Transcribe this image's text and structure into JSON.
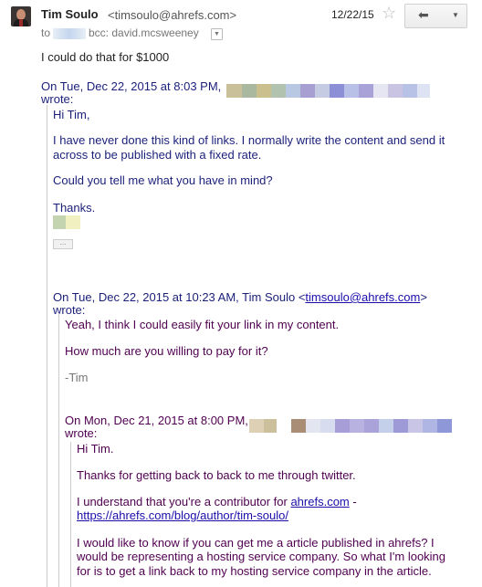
{
  "header": {
    "sender_name": "Tim Soulo",
    "sender_email": "<timsoulo@ahrefs.com>",
    "date": "12/22/15",
    "to_label": "to",
    "bcc_text": "bcc: david.mcsweeney",
    "star_icon": "star-outline-icon",
    "reply_icon": "reply-icon",
    "more_icon": "chevron-down-icon"
  },
  "body": {
    "reply_text": "I could do that for $1000"
  },
  "quote1": {
    "attribution": "On Tue, Dec 22, 2015 at 8:03 PM,",
    "wrote": "wrote:",
    "greeting": "Hi Tim,",
    "para1_line1": "I have never done this kind of links. I normally write the content and send it",
    "para1_line2": "across to be published with a fixed rate.",
    "para2": "Could you tell me what you have in mind?",
    "thanks": "Thanks.",
    "ellipsis": "..."
  },
  "quote2": {
    "attribution_prefix": "On Tue, Dec 22, 2015 at 10:23 AM, Tim Soulo <",
    "attribution_email": "timsoulo@ahrefs.com",
    "attribution_suffix": ">",
    "wrote": "wrote:",
    "line1": "Yeah, I think I could easily fit your link in my content.",
    "line2": "How much are you willing to pay for it?",
    "signature": "-Tim"
  },
  "quote3": {
    "attribution": "On Mon, Dec 21, 2015 at 8:00 PM,",
    "wrote": "wrote:",
    "greeting": "Hi Tim.",
    "line1": "Thanks for getting back to back to me through twitter.",
    "line2_prefix": "I understand that you're a contributor for ",
    "line2_link": "ahrefs.com",
    "line2_suffix": " -",
    "line3_link": "https://ahrefs.com/blog/author/tim-soulo/",
    "para_line1": "I would like to know if you can get me a article published in ahrefs? I",
    "para_line2": "would be representing a hosting service company. So what I'm looking",
    "para_line3": "for is to get a link back to my hosting service company in the article."
  },
  "colors": {
    "quote_level1": "#1a1f7a",
    "quote_level2": "#500050",
    "link": "#1a0dab"
  }
}
